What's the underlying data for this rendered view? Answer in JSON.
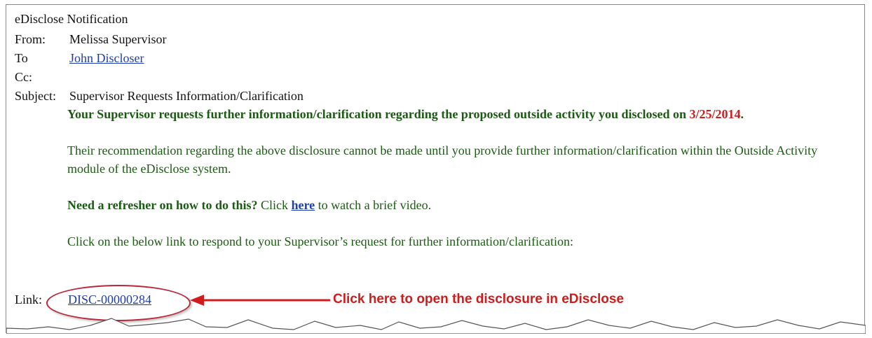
{
  "email": {
    "title": "eDisclose Notification",
    "from_label": "From:",
    "from_value": "Melissa Supervisor",
    "to_label": "To",
    "to_value": "John Discloser",
    "cc_label": "Cc:",
    "subject_label": "Subject:",
    "subject_value": "Supervisor Requests Information/Clarification",
    "link_label": "Link:",
    "link_value": "DISC-00000284"
  },
  "body": {
    "p1_text": "Your Supervisor requests further information/clarification regarding the proposed outside activity you disclosed on",
    "p1_date": "3/25/2014",
    "p1_end": ".",
    "p2_text": "Their recommendation regarding the above disclosure cannot be made until you provide further information/clarification within the Outside Activity module of the eDisclose system.",
    "p3_bold": "Need a refresher on how to do this?",
    "p3_click": " Click ",
    "p3_link": "here",
    "p3_rest": " to watch a brief video.",
    "p4_text": "Click on the below link to respond to your Supervisor’s request for further information/clarification:"
  },
  "annotation": {
    "text": "Click here to open the disclosure in eDisclose",
    "color": "#d01c1c"
  },
  "colors": {
    "green_text": "#1c5a14",
    "date_red": "#cc1f1f",
    "link_blue": "#1f3fa8",
    "oval_red": "#b8283a"
  }
}
